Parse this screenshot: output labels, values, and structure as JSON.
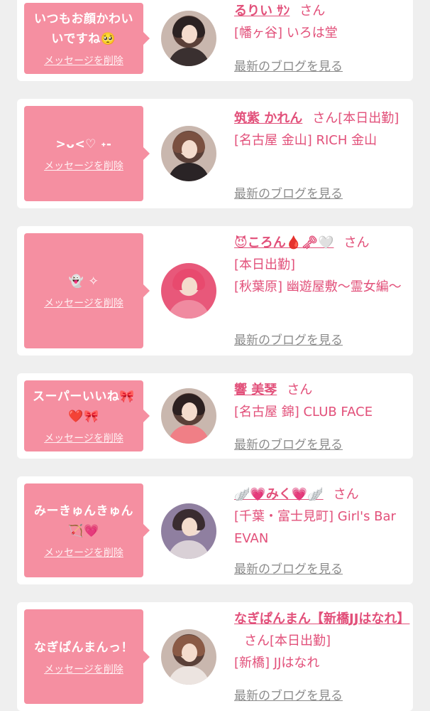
{
  "cards": [
    {
      "message": "いつもお顔かわい\nいですね🥺",
      "delete_label": "メッセージを削除",
      "name": "るりい ｻﾝ",
      "suffix": "さん",
      "shop": "[幡ヶ谷] いろは堂",
      "blog_label": "最新のブログを見る"
    },
    {
      "message": ">ᴗ<♡ ˖-",
      "delete_label": "メッセージを削除",
      "name": "筑紫 かれん",
      "suffix": "さん[本日出勤]",
      "shop": "[名古屋 金山] RICH 金山",
      "blog_label": "最新のブログを見る"
    },
    {
      "message": "👻 ✧",
      "delete_label": "メッセージを削除",
      "name": "😈ころん🩸🗝🤍",
      "suffix": "さん",
      "shop": "[本日出勤]\n[秋葉原] 幽遊屋敷～霊女編～",
      "blog_label": "最新のブログを見る"
    },
    {
      "message": "スーパーいいね🎀\n❤️🎀",
      "delete_label": "メッセージを削除",
      "name": "響 美琴",
      "suffix": "さん",
      "shop": "[名古屋 錦] CLUB FACE",
      "blog_label": "最新のブログを見る"
    },
    {
      "message": "みーきゅんきゅん\n🏹💗",
      "delete_label": "メッセージを削除",
      "name": "🪽💗みく💗🪽",
      "suffix": "さん",
      "shop": "[千葉・富士見町] Girl's Bar EVAN",
      "blog_label": "最新のブログを見る"
    },
    {
      "message": "なぎぱんまんっ！",
      "delete_label": "メッセージを削除",
      "name": "なぎぱんまん【新橋JJはなれ】",
      "suffix": "さん[本日出勤]",
      "shop": "[新橋] JJはなれ",
      "blog_label": "最新のブログを見る"
    }
  ],
  "colors": {
    "bubble": "#f58fa1",
    "accent_text": "#e2507a",
    "muted_link": "#8c8c8c",
    "background": "#efefef"
  }
}
